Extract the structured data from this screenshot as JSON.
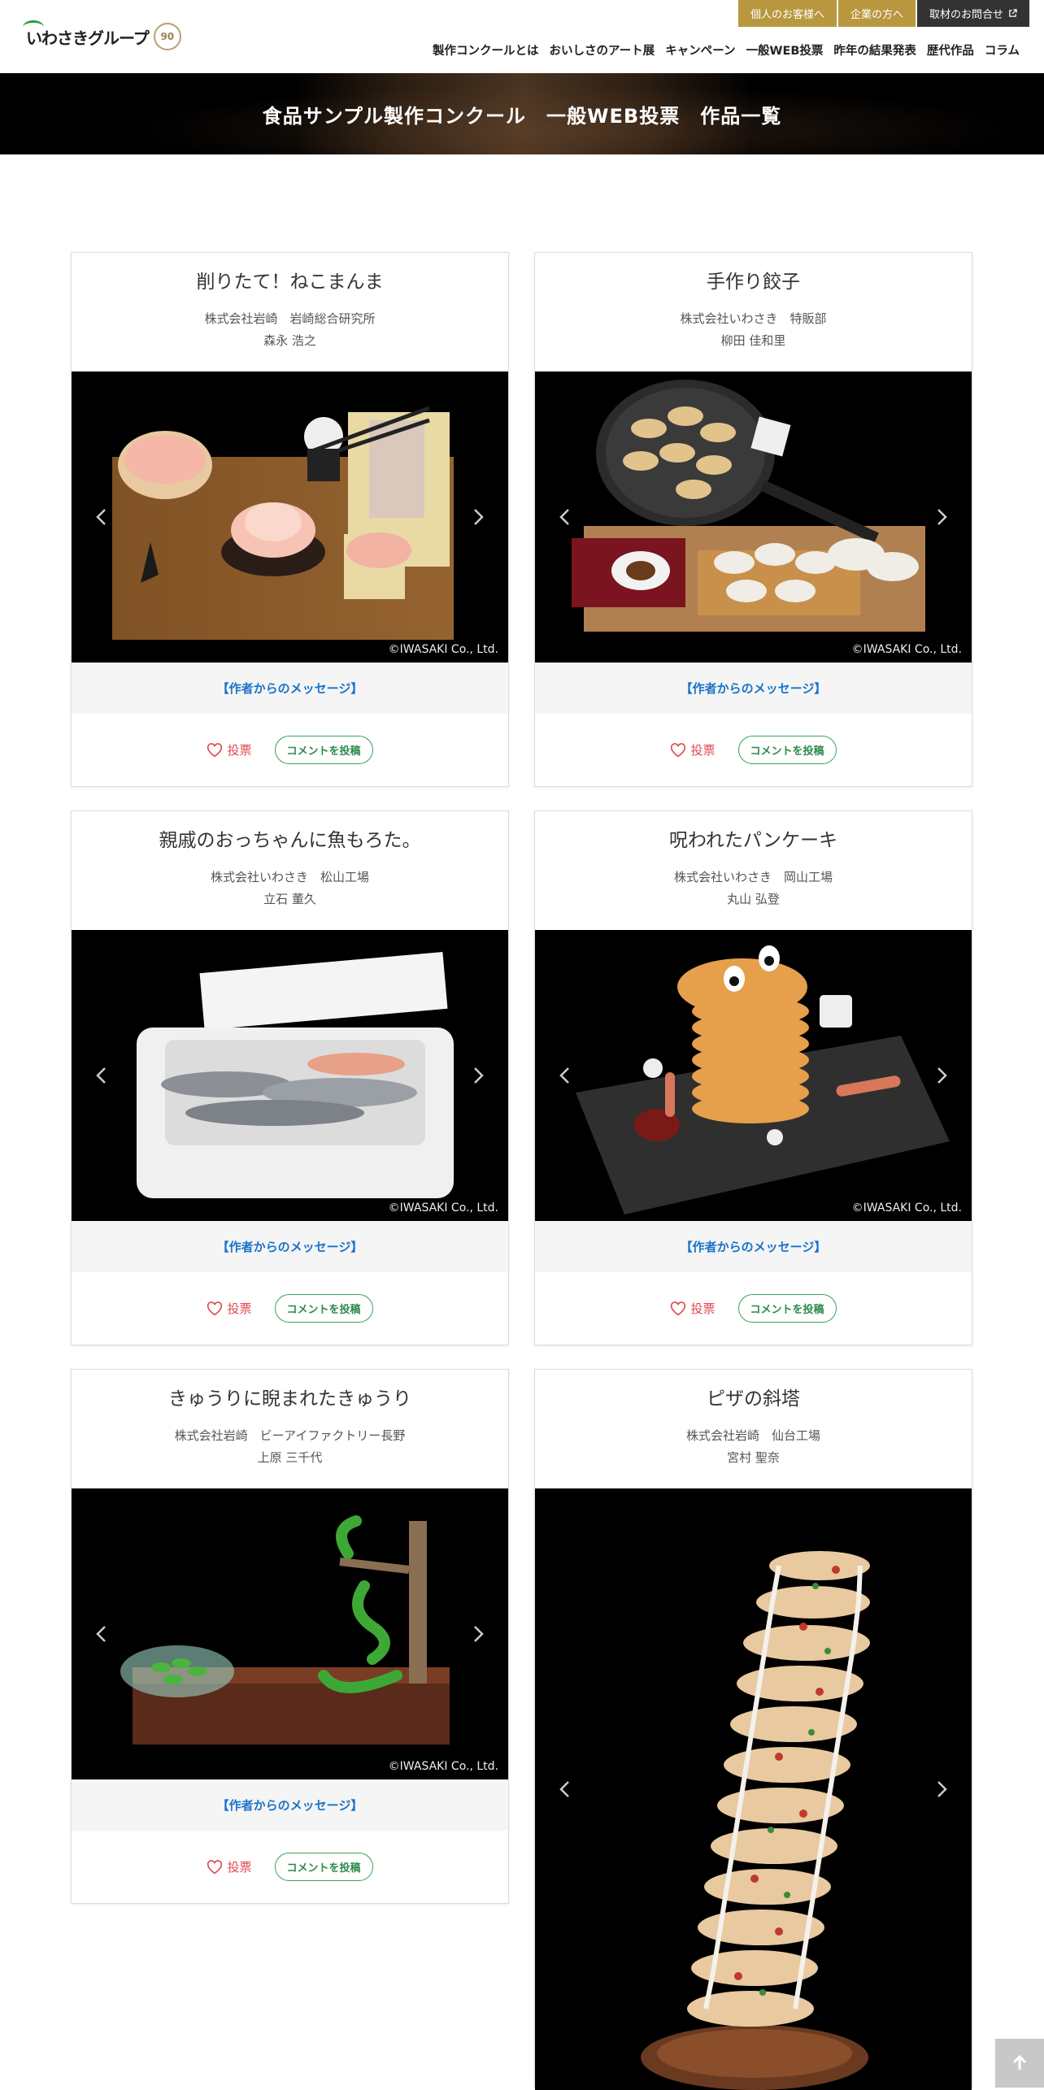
{
  "header": {
    "logo_text": "いわさきグループ",
    "logo_badge": "90",
    "top_buttons": [
      "個人のお客様へ",
      "企業の方へ",
      "取材のお問合せ"
    ],
    "nav": [
      "製作コンクールとは",
      "おいしさのアート展",
      "キャンペーン",
      "一般WEB投票",
      "昨年の結果発表",
      "歴代作品",
      "コラム"
    ]
  },
  "banner": {
    "title": "食品サンプル製作コンクール　一般WEB投票　作品一覧"
  },
  "card_ui": {
    "message_label": "【作者からのメッセージ】",
    "vote_label": "投票",
    "comment_label": "コメントを投稿",
    "copyright": "©IWASAKI Co., Ltd."
  },
  "cards": [
    {
      "title": "削りたて！ねこまんま",
      "company": "株式会社岩崎　岩崎総合研究所",
      "author": "森永 浩之"
    },
    {
      "title": "手作り餃子",
      "company": "株式会社いわさき　特販部",
      "author": "柳田 佳和里"
    },
    {
      "title": "親戚のおっちゃんに魚もろた。",
      "company": "株式会社いわさき　松山工場",
      "author": "立石 董久"
    },
    {
      "title": "呪われたパンケーキ",
      "company": "株式会社いわさき　岡山工場",
      "author": "丸山 弘登"
    },
    {
      "title": "きゅうりに睨まれたきゅうり",
      "company": "株式会社岩崎　ビーアイファクトリー長野",
      "author": "上原 三千代"
    },
    {
      "title": "ピザの斜塔",
      "company": "株式会社岩崎　仙台工場",
      "author": "宮村 聖奈"
    }
  ],
  "colors": {
    "gold": "#b8973f",
    "dark": "#333333",
    "link_blue": "#1a73c9",
    "vote_red": "#e0474c",
    "comment_green": "#3aa35b"
  }
}
